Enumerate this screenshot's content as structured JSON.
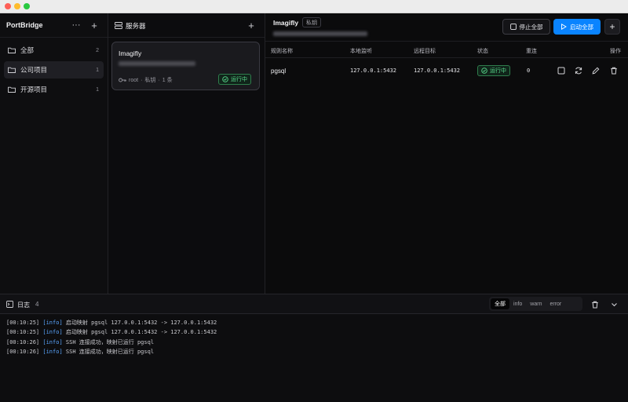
{
  "app": {
    "title": "PortBridge"
  },
  "sidebar": {
    "items": [
      {
        "label": "全部",
        "count": "2"
      },
      {
        "label": "公司项目",
        "count": "1"
      },
      {
        "label": "开源项目",
        "count": "1"
      }
    ]
  },
  "servers": {
    "header": "服务器",
    "card": {
      "name": "Imagifly",
      "user": "root",
      "auth": "私钥",
      "rules": "1 条",
      "status": "运行中"
    }
  },
  "detail": {
    "name": "Imagifly",
    "tag": "私钥",
    "stop_all": "停止全部",
    "start_all": "启动全部",
    "columns": [
      "规则名称",
      "本地监听",
      "远程目标",
      "状态",
      "重连",
      "操作"
    ],
    "rows": [
      {
        "name": "pgsql",
        "local": "127.0.0.1:5432",
        "remote": "127.0.0.1:5432",
        "status": "运行中",
        "reconnect": "0"
      }
    ]
  },
  "logs": {
    "title": "日志",
    "count": "4",
    "filters": [
      "全部",
      "info",
      "warn",
      "error"
    ],
    "lines": [
      {
        "time": "[00:10:25]",
        "level": "[info]",
        "msg": " 启动映射 pgsql 127.0.0.1:5432 -> 127.0.0.1:5432"
      },
      {
        "time": "[00:10:25]",
        "level": "[info]",
        "msg": " 启动映射 pgsql 127.0.0.1:5432 -> 127.0.0.1:5432"
      },
      {
        "time": "[00:10:26]",
        "level": "[info]",
        "msg": " SSH 连接成功，映射已运行 pgsql"
      },
      {
        "time": "[00:10:26]",
        "level": "[info]",
        "msg": " SSH 连接成功，映射已运行 pgsql"
      }
    ]
  },
  "colors": {
    "accent": "#0a84ff",
    "success": "#57d68a"
  }
}
